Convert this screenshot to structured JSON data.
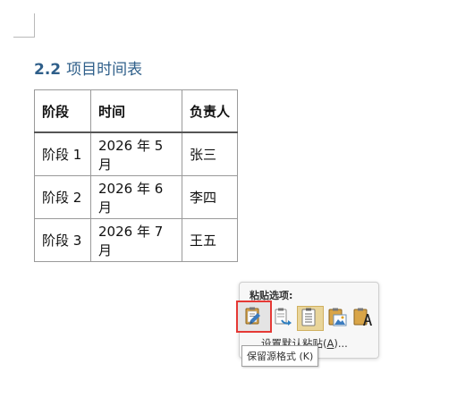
{
  "document": {
    "heading": {
      "number": "2.2",
      "title": "项目时间表"
    },
    "table": {
      "headers": [
        "阶段",
        "时间",
        "负责人"
      ],
      "rows": [
        [
          "阶段 1",
          "2026 年 5 月",
          "张三"
        ],
        [
          "阶段 2",
          "2026 年 6 月",
          "李四"
        ],
        [
          "阶段 3",
          "2026 年 7 月",
          "王五"
        ]
      ]
    }
  },
  "paste_options": {
    "title": "粘贴选项:",
    "buttons": [
      {
        "name": "keep-source-formatting",
        "icon": "clipboard-brush-icon"
      },
      {
        "name": "merge-formatting",
        "icon": "clipboard-arrow-icon"
      },
      {
        "name": "paste-as-text-table",
        "icon": "clipboard-doc-icon"
      },
      {
        "name": "paste-as-picture",
        "icon": "clipboard-picture-icon"
      },
      {
        "name": "keep-text-only",
        "icon": "clipboard-text-icon"
      }
    ],
    "default_link": {
      "prefix": "设置默认粘贴(",
      "key": "A",
      "suffix": ")..."
    },
    "tooltip": "保留源格式 (K)"
  },
  "colors": {
    "heading": "#2f5f8a",
    "highlight_border": "#e53935",
    "selected_button": "#e9d59a"
  }
}
